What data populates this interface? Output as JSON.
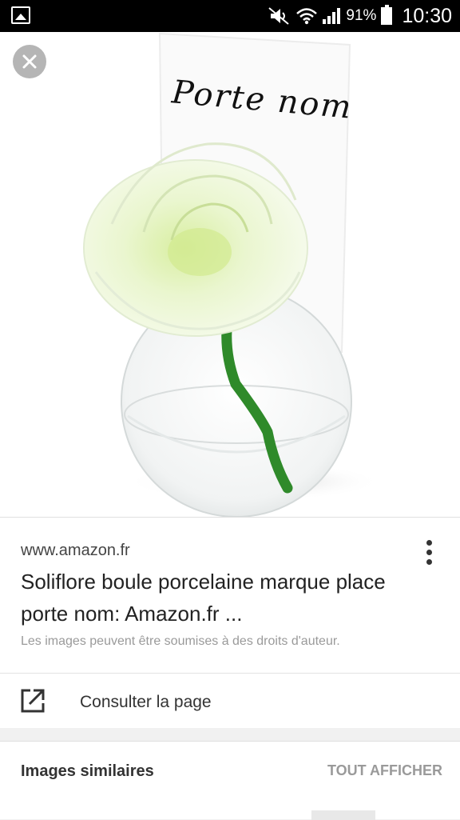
{
  "status_bar": {
    "battery_percent": "91%",
    "time": "10:30",
    "icons": [
      "gallery-icon",
      "mute-icon",
      "wifi-icon",
      "signal-icon",
      "battery-icon"
    ]
  },
  "viewer": {
    "close_icon": "close-icon",
    "image": {
      "card_text": "Porte nom"
    }
  },
  "result": {
    "source": "www.amazon.fr",
    "title": "Soliflore boule porcelaine marque place porte nom: Amazon.fr ...",
    "rights_notice": "Les images peuvent être soumises à des droits d'auteur.",
    "visit_label": "Consulter la page"
  },
  "similar": {
    "title": "Images similaires",
    "see_all_label": "TOUT AFFICHER"
  },
  "colors": {
    "status_bar_bg": "#000000",
    "page_bg": "#f1f1f1",
    "card_bg": "#ffffff",
    "close_button_bg": "#b5b5b5",
    "stem_green": "#2f8a2a"
  }
}
